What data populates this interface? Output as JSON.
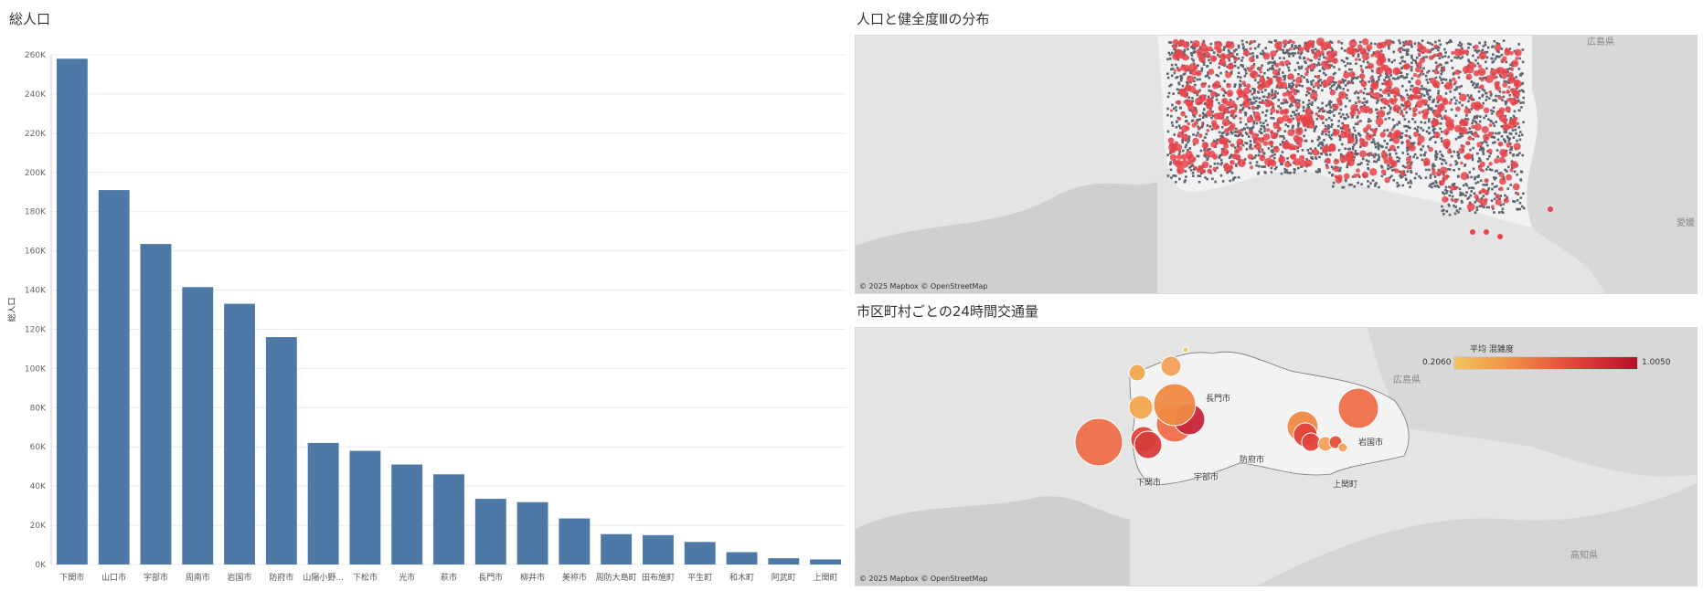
{
  "bar_panel": {
    "title": "総人口"
  },
  "map1": {
    "title": "人口と健全度Ⅲの分布",
    "attribution": "© 2025 Mapbox  © OpenStreetMap",
    "pref_labels": [
      "広島県",
      "愛媛"
    ]
  },
  "map2": {
    "title": "市区町村ごとの24時間交通量",
    "attribution": "© 2025 Mapbox  © OpenStreetMap",
    "legend": {
      "title": "平均 混雑度",
      "min": "0.2060",
      "max": "1.0050"
    },
    "pref_labels": [
      "広島県",
      "高知県"
    ],
    "city_labels": [
      "長門市",
      "下関市",
      "宇部市",
      "防府市",
      "岩国市",
      "上関町"
    ]
  },
  "chart_data": {
    "type": "bar",
    "ylabel": "総人口",
    "ylim": [
      0,
      260000
    ],
    "yticks": [
      "0K",
      "20K",
      "40K",
      "60K",
      "80K",
      "100K",
      "120K",
      "140K",
      "160K",
      "180K",
      "200K",
      "220K",
      "240K",
      "260K"
    ],
    "categories": [
      "下関市",
      "山口市",
      "宇部市",
      "周南市",
      "岩国市",
      "防府市",
      "山陽小野...",
      "下松市",
      "光市",
      "萩市",
      "長門市",
      "柳井市",
      "美祢市",
      "周防大島町",
      "田布施町",
      "平生町",
      "和木町",
      "阿武町",
      "上関町"
    ],
    "values": [
      258000,
      191000,
      163500,
      141500,
      133000,
      116000,
      62000,
      58000,
      51000,
      46000,
      33500,
      31800,
      23500,
      15500,
      15000,
      11500,
      6300,
      3200,
      2600
    ],
    "color": "#4e79a7"
  },
  "colors": {
    "bar": "#4e79a7",
    "gray_dot": "#5d6570",
    "red_dot": "#e8434a",
    "land": "#f2f2f2",
    "sea": "#e6e6e6"
  }
}
